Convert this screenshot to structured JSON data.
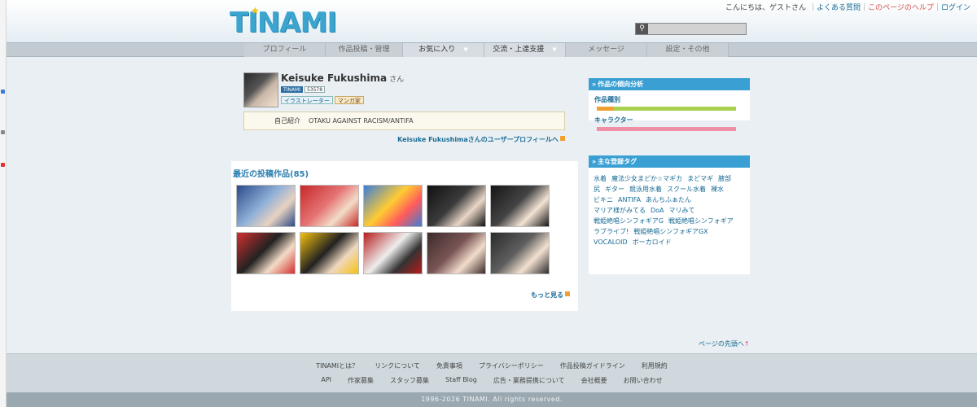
{
  "header": {
    "logo": "TINAMI",
    "greeting": "こんにちは、ゲストさん",
    "links": [
      "よくある質問",
      "このページのヘルプ",
      "ログイン"
    ],
    "search_placeholder": ""
  },
  "nav": {
    "items": [
      {
        "label": "プロフィール",
        "dropdown": false
      },
      {
        "label": "作品投稿・管理",
        "dropdown": false
      },
      {
        "label": "お気に入り",
        "dropdown": true
      },
      {
        "label": "交流・上達支援",
        "dropdown": true
      },
      {
        "label": "メッセージ",
        "dropdown": false
      },
      {
        "label": "設定・その他",
        "dropdown": false
      }
    ]
  },
  "profile": {
    "name": "Keisuke Fukushima",
    "suffix": "さん",
    "badge_label": "TINAMI",
    "badge_id": "53578",
    "roles": [
      "イラストレーター",
      "マンガ家"
    ],
    "intro_label": "自己紹介",
    "intro_text": "OTAKU AGAINST RACISM/ANTIFA",
    "profile_link": "Keisuke Fukushimaさんのユーザープロフィールへ"
  },
  "works": {
    "title": "最近の投稿作品(85)",
    "more": "もっと見る",
    "thumbnails": [
      {
        "name": "thumb-1",
        "colors": [
          "#2a4a8a",
          "#8fb0d8",
          "#e8d2c0"
        ]
      },
      {
        "name": "thumb-2",
        "colors": [
          "#c62828",
          "#e57373",
          "#f2dcc8"
        ]
      },
      {
        "name": "thumb-3",
        "colors": [
          "#3b7dd8",
          "#ffcc33",
          "#ff5b5b"
        ]
      },
      {
        "name": "thumb-4",
        "colors": [
          "#111111",
          "#3a3a3a",
          "#e9d6c6"
        ]
      },
      {
        "name": "thumb-5",
        "colors": [
          "#151515",
          "#444444",
          "#f3e3d3"
        ]
      },
      {
        "name": "thumb-6",
        "colors": [
          "#d32f2f",
          "#222222",
          "#f3dcc6"
        ]
      },
      {
        "name": "thumb-7",
        "colors": [
          "#f4c20d",
          "#222222",
          "#f0d8c0"
        ]
      },
      {
        "name": "thumb-8",
        "colors": [
          "#b71c1c",
          "#eeeeee",
          "#333333"
        ]
      },
      {
        "name": "thumb-9",
        "colors": [
          "#3d2a2a",
          "#7a5555",
          "#f1dccb"
        ]
      },
      {
        "name": "thumb-10",
        "colors": [
          "#2b2b2b",
          "#5e5e5e",
          "#f3e0d0"
        ]
      }
    ]
  },
  "sidebar": {
    "analysis": {
      "title": "作品の傾向分析",
      "rows": [
        {
          "label": "作品種別",
          "color": "#f0a030",
          "color2": "#a8d14e"
        },
        {
          "label": "キャラクター",
          "color": "#ef8fa8",
          "color2": "#ef8fa8"
        }
      ]
    },
    "tags": {
      "title": "主な登録タグ",
      "items": [
        "水着",
        "魔法少女まどか☆マギカ",
        "まどマギ",
        "腋部",
        "尻",
        "ギター",
        "競泳用水着",
        "スクール水着",
        "裸水",
        "ビキニ",
        "ANTIFA",
        "あんちふぁたん",
        "マリア様がみてる",
        "DoA",
        "マリみて",
        "戦姫絶唱シンフォギアG",
        "戦姫絶唱シンフォギア",
        "ラブライブ!",
        "戦姫絶唱シンフォギアGX",
        "VOCALOID",
        "ボーカロイド"
      ]
    }
  },
  "back_to_top": "ページの先頭へ",
  "footer": {
    "row1": [
      "TINAMIとは？",
      "リンクについて",
      "免責事項",
      "プライバシーポリシー",
      "作品投稿ガイドライン",
      "利用規約"
    ],
    "row2": [
      "API",
      "作家募集",
      "スタッフ募集",
      "Staff Blog",
      "広告・業務提携について",
      "会社概要",
      "お問い合わせ"
    ],
    "copyright": "1996-2026 TINAMI. All rights reserved."
  }
}
